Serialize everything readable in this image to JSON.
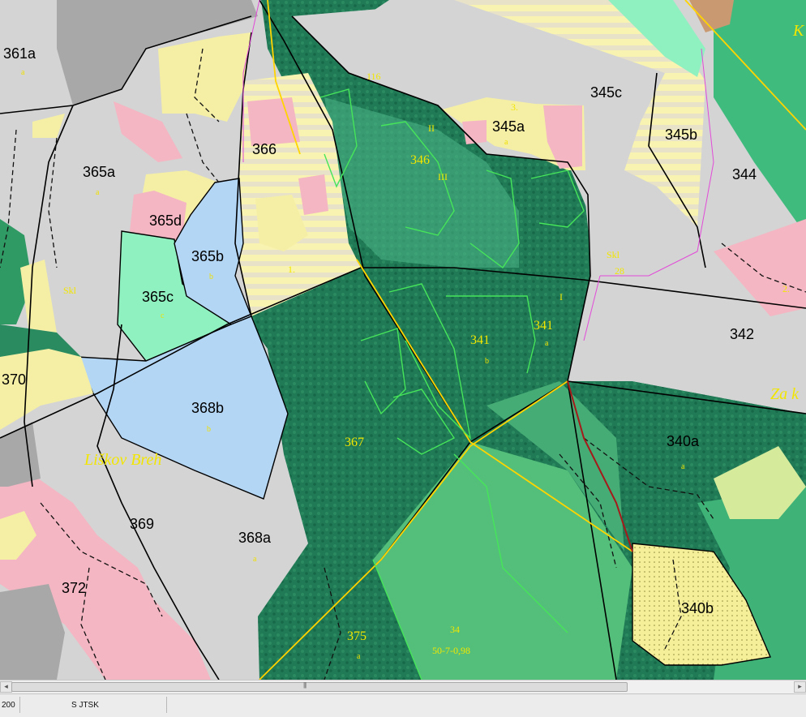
{
  "map": {
    "stands": [
      {
        "id": "361a",
        "sub": "a"
      },
      {
        "id": "365a",
        "sub": "a"
      },
      {
        "id": "365b",
        "sub": "b"
      },
      {
        "id": "365c",
        "sub": "c"
      },
      {
        "id": "365d",
        "sub": ""
      },
      {
        "id": "366",
        "sub": ""
      },
      {
        "id": "370",
        "sub": ""
      },
      {
        "id": "368b",
        "sub": "b"
      },
      {
        "id": "369",
        "sub": ""
      },
      {
        "id": "368a",
        "sub": "a"
      },
      {
        "id": "372",
        "sub": ""
      },
      {
        "id": "367",
        "sub": ""
      },
      {
        "id": "346",
        "sub": ""
      },
      {
        "id": "345a",
        "sub": "a"
      },
      {
        "id": "345c",
        "sub": ""
      },
      {
        "id": "345b",
        "sub": ""
      },
      {
        "id": "344",
        "sub": ""
      },
      {
        "id": "342",
        "sub": ""
      },
      {
        "id": "341",
        "sub": "a"
      },
      {
        "id": "341",
        "sub": "b"
      },
      {
        "id": "340a",
        "sub": "a"
      },
      {
        "id": "340b",
        "sub": ""
      },
      {
        "id": "375",
        "sub": "a"
      }
    ],
    "place_names": [
      "Liškov Breh",
      "Za k",
      "K"
    ],
    "small_labels": [
      "116",
      "Skl",
      "Skl",
      "28",
      "34",
      "50-7-0,98",
      "II",
      "III",
      "I",
      "1.",
      "2.",
      "3."
    ],
    "colors": {
      "forest_dark": "#1d7a55",
      "forest_light": "#3aa86e",
      "meadow": "#4fc07a",
      "grey_parcel": "#d4d4d4",
      "pink_parcel": "#f4b6c2",
      "yellow_parcel": "#f6f0a0",
      "blue_parcel": "#b4d6f5",
      "mint_parcel": "#8ff0c0",
      "boundary": "#000000",
      "road": "#ffd400"
    }
  },
  "scrollbar": {
    "grip": "|||"
  },
  "statusbar": {
    "scale": "200",
    "crs": "S JTSK"
  }
}
